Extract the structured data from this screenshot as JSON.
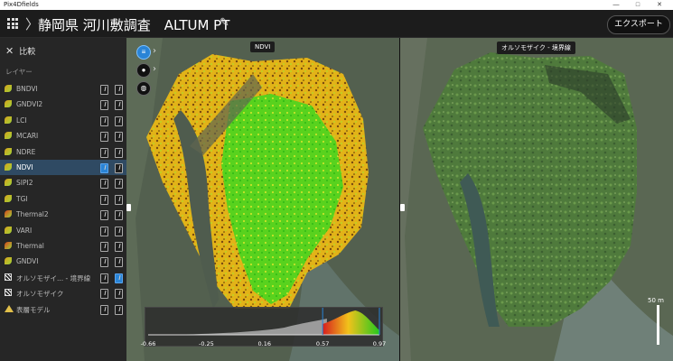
{
  "window": {
    "app_name": "Pix4Dfields",
    "minimize": "—",
    "maximize": "□",
    "close": "✕"
  },
  "header": {
    "project_title": "静岡県 河川敷調査　ALTUM PT",
    "export_label": "エクスポート"
  },
  "sidebar": {
    "compare_label": "比較",
    "layers_title": "レイヤー",
    "layers": [
      {
        "name": "BNDVI",
        "icon": "index-leaf-icon",
        "left_checked": false,
        "right_checked": false,
        "selected": false
      },
      {
        "name": "GNDVI2",
        "icon": "index-leaf-icon",
        "left_checked": false,
        "right_checked": false,
        "selected": false
      },
      {
        "name": "LCI",
        "icon": "index-leaf-icon",
        "left_checked": false,
        "right_checked": false,
        "selected": false
      },
      {
        "name": "MCARI",
        "icon": "index-leaf-icon",
        "left_checked": false,
        "right_checked": false,
        "selected": false
      },
      {
        "name": "NDRE",
        "icon": "index-leaf-icon",
        "left_checked": false,
        "right_checked": false,
        "selected": false
      },
      {
        "name": "NDVI",
        "icon": "index-leaf-icon",
        "left_checked": true,
        "right_checked": false,
        "selected": true
      },
      {
        "name": "SIPI2",
        "icon": "index-leaf-icon",
        "left_checked": false,
        "right_checked": false,
        "selected": false
      },
      {
        "name": "TGI",
        "icon": "index-leaf-icon",
        "left_checked": false,
        "right_checked": false,
        "selected": false
      },
      {
        "name": "Thermal2",
        "icon": "thermal-leaf-icon",
        "left_checked": false,
        "right_checked": false,
        "selected": false
      },
      {
        "name": "VARI",
        "icon": "index-leaf-icon",
        "left_checked": false,
        "right_checked": false,
        "selected": false
      },
      {
        "name": "Thermal",
        "icon": "thermal-leaf-icon",
        "left_checked": false,
        "right_checked": false,
        "selected": false
      },
      {
        "name": "GNDVI",
        "icon": "index-leaf-icon",
        "left_checked": false,
        "right_checked": false,
        "selected": false
      },
      {
        "name": "オルソモザイ... - 境界線",
        "icon": "orthomosaic-icon",
        "left_checked": false,
        "right_checked": true,
        "selected": false
      },
      {
        "name": "オルソモザイク",
        "icon": "orthomosaic-icon",
        "left_checked": false,
        "right_checked": false,
        "selected": false
      },
      {
        "name": "表層モデル",
        "icon": "elevation-model-icon",
        "left_checked": false,
        "right_checked": false,
        "selected": false
      }
    ]
  },
  "left_map": {
    "label": "NDVI"
  },
  "right_map": {
    "label": "オルソモザイク - 境界線",
    "scale_label": "50 m"
  },
  "legend": {
    "ticks": [
      "-0.66",
      "-0.25",
      "0.16",
      "0.57",
      "0.97"
    ],
    "tick_values": [
      -0.66,
      -0.25,
      0.16,
      0.57,
      0.97
    ],
    "range_low": 0.57,
    "range_high": 0.97
  },
  "colors": {
    "selected_row": "#2f4a63",
    "accent": "#2a84d6",
    "ndvi_low": "#e8b21b",
    "ndvi_high": "#2fd21b"
  }
}
